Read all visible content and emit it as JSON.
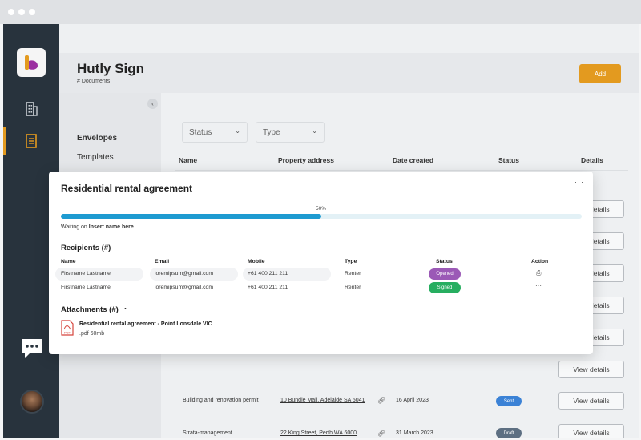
{
  "app": {
    "title": "Hutly Sign",
    "breadcrumb": "# Documents",
    "add_label": "Add"
  },
  "leftnav": {
    "items": [
      {
        "label": "Envelopes",
        "active": true
      },
      {
        "label": "Templates",
        "active": false
      }
    ]
  },
  "filters": {
    "status": "Status",
    "type": "Type"
  },
  "table": {
    "headers": [
      "Name",
      "Property address",
      "Date created",
      "Status",
      "Details"
    ],
    "view_label": "View details",
    "rows": [
      {
        "name": "Building and renovation permit",
        "address": "10 Bundle Mall, Adelaide SA 5041",
        "date": "16 April 2023",
        "status": "Sent",
        "status_color": "#3b82d6"
      },
      {
        "name": "Strata-management",
        "address": "22 King Street, Perth WA 6000",
        "date": "31 March 2023",
        "status": "Draft",
        "status_color": "#5d6f82"
      }
    ]
  },
  "modal": {
    "title": "Residential rental agreement",
    "progress_percent": 50,
    "progress_label": "50%",
    "waiting_prefix": "Waiting on ",
    "waiting_name": "Insert name here",
    "recipients_title": "Recipients (#)",
    "recipient_headers": [
      "Name",
      "Email",
      "Mobile",
      "Type",
      "Status",
      "Action"
    ],
    "recipients": [
      {
        "name": "Firstname Lastname",
        "email": "loremipsum@gmail.com",
        "mobile": "+61 400 211 211",
        "type": "Renter",
        "status": "Opened",
        "status_color": "#9b59b6"
      },
      {
        "name": "Firstname Lastname",
        "email": "loremipsum@gmail.com",
        "mobile": "+61 400 211 211",
        "type": "Renter",
        "status": "Signed",
        "status_color": "#27ae60"
      }
    ],
    "attachments_title": "Attachments (#)",
    "attachment": {
      "name": "Residential rental agreement - Point Lonsdale VIC",
      "meta": ".pdf 60mb",
      "icon_label": "PDF"
    }
  },
  "colors": {
    "accent": "#e39a1f",
    "sidebar": "#28333d",
    "progress": "#1e9bd1"
  }
}
